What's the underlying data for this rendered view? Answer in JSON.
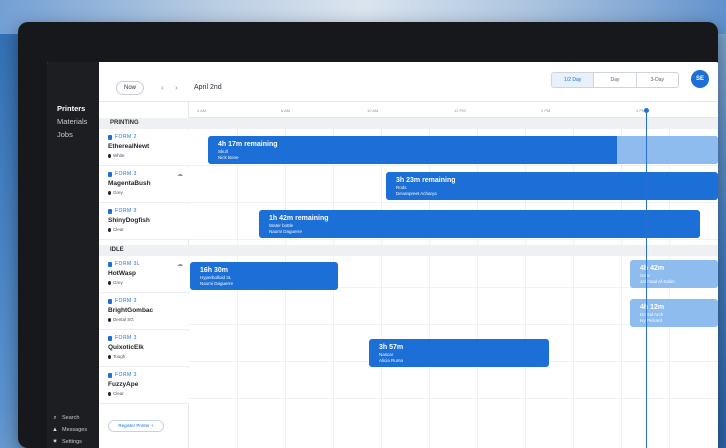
{
  "sidebar": {
    "items": [
      {
        "label": "Printers"
      },
      {
        "label": "Materials"
      },
      {
        "label": "Jobs"
      }
    ],
    "bottom": [
      {
        "label": "Search",
        "icon": "search-icon"
      },
      {
        "label": "Messages",
        "icon": "bell-icon"
      },
      {
        "label": "Settings",
        "icon": "gear-icon"
      }
    ]
  },
  "header": {
    "now_label": "Now",
    "prev": "‹",
    "next": "›",
    "date": "April 2nd",
    "views": [
      "1/2 Day",
      "Day",
      "3-Day"
    ],
    "avatar": "SE"
  },
  "timescale": [
    "4 AM",
    "6 AM",
    "10 AM",
    "12 PM",
    "2 PM",
    "4 PM"
  ],
  "sections": {
    "printing": "PRINTING",
    "idle": "IDLE"
  },
  "printers": [
    {
      "model": "FORM 2",
      "name": "EtherealNewt",
      "material": "White",
      "cloud": false
    },
    {
      "model": "FORM 3",
      "name": "MagentaBush",
      "material": "Grey",
      "cloud": true
    },
    {
      "model": "FORM 3",
      "name": "ShinyDogfish",
      "material": "Clear",
      "cloud": false
    },
    {
      "model": "FORM 3L",
      "name": "HotWasp",
      "material": "Grey",
      "cloud": true
    },
    {
      "model": "FORM 3",
      "name": "BrightGombac",
      "material": "Dental SG",
      "cloud": false
    },
    {
      "model": "FORM 3",
      "name": "QuixoticElk",
      "material": "Tough",
      "cloud": false
    },
    {
      "model": "FORM 3",
      "name": "FuzzyApe",
      "material": "Clear",
      "cloud": false
    }
  ],
  "jobs": [
    {
      "title": "4h 17m remaining",
      "file": "Skull",
      "user": "Nick Bone"
    },
    {
      "title": "3h 23m remaining",
      "file": "Rods",
      "user": "Devanpreet Acharya"
    },
    {
      "title": "1h 42m remaining",
      "file": "Water bottle",
      "user": "Naomi Daguerre"
    },
    {
      "title": "16h 30m",
      "file": "Hyperbolloid 3L",
      "user": "Naomi Daguerre"
    },
    {
      "title": "3h 57m",
      "file": "Nascar",
      "user": "Alicia Ruma"
    },
    {
      "title": "4h 42m",
      "file": "Gear",
      "user": "Jahmaal Al-Salim"
    },
    {
      "title": "4h 12m",
      "file": "Dental Arch",
      "user": "Ivy Pickard"
    }
  ],
  "register_button": "Register Printer +",
  "colors": {
    "accent": "#1c6fd6",
    "accent_faded": "#8fbcee",
    "sidebar": "#1c1e22"
  }
}
